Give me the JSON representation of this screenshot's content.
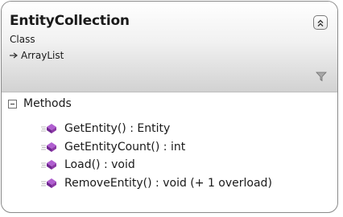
{
  "class": {
    "name": "EntityCollection",
    "kind": "Class",
    "base_type": "ArrayList"
  },
  "icons": {
    "collapse": "double-chevron-up-icon",
    "filter": "filter-icon",
    "inheritance": "inheritance-arrow-icon",
    "method": "method-icon",
    "section_toggle": "minus-box-icon"
  },
  "colors": {
    "border": "#8a8a8a",
    "header_gradient_top": "#ffffff",
    "header_gradient_bottom": "#d2d2d2",
    "method_icon": "#8c3aa6"
  },
  "sections": [
    {
      "label": "Methods",
      "members": [
        {
          "label": "GetEntity() : Entity"
        },
        {
          "label": "GetEntityCount() : int"
        },
        {
          "label": "Load() : void"
        },
        {
          "label": "RemoveEntity() : void (+ 1 overload)"
        }
      ]
    }
  ]
}
